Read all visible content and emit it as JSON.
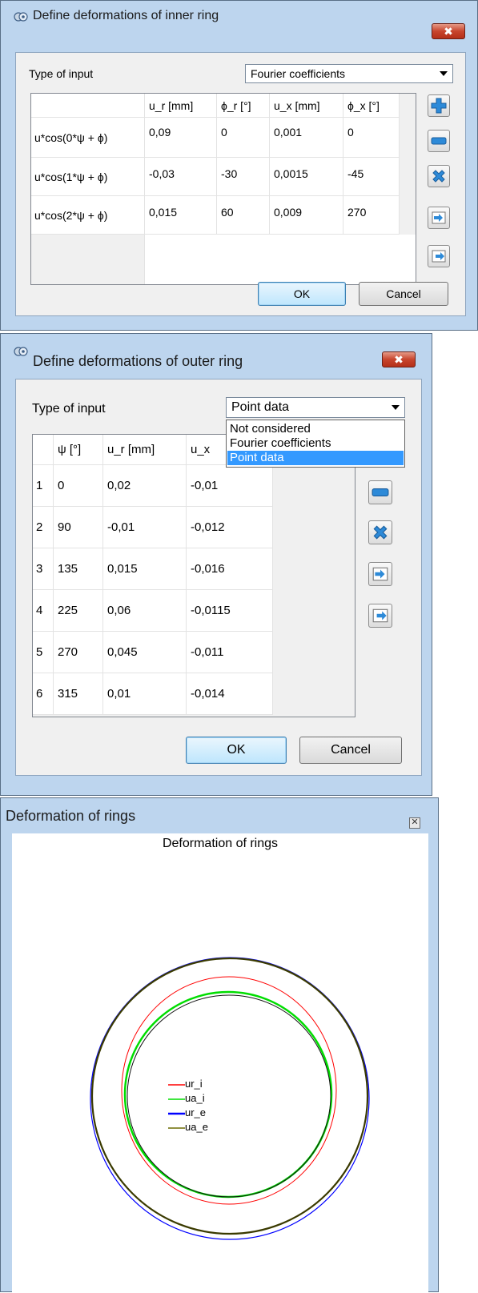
{
  "inner_dialog": {
    "title": "Define deformations of inner ring",
    "type_label": "Type of input",
    "type_value": "Fourier coefficients",
    "headers": [
      "u_r [mm]",
      "ϕ_r [°]",
      "u_x [mm]",
      "ϕ_x [°]"
    ],
    "rows": [
      {
        "label": "u*cos(0*ψ + ϕ)",
        "cells": [
          "0,09",
          "0",
          "0,001",
          "0"
        ]
      },
      {
        "label": "u*cos(1*ψ + ϕ)",
        "cells": [
          "-0,03",
          "-30",
          "0,0015",
          "-45"
        ]
      },
      {
        "label": "u*cos(2*ψ + ϕ)",
        "cells": [
          "0,015",
          "60",
          "0,009",
          "270"
        ]
      }
    ],
    "ok_label": "OK",
    "cancel_label": "Cancel",
    "close_glyph": "✖"
  },
  "outer_dialog": {
    "title": "Define deformations of outer ring",
    "type_label": "Type of input",
    "type_value": "Point data",
    "headers": [
      "ψ [°]",
      "u_r [mm]",
      "u_x"
    ],
    "rows": [
      {
        "num": "1",
        "cells": [
          "0",
          "0,02",
          "-0,01"
        ]
      },
      {
        "num": "2",
        "cells": [
          "90",
          "-0,01",
          "-0,012"
        ]
      },
      {
        "num": "3",
        "cells": [
          "135",
          "0,015",
          "-0,016"
        ]
      },
      {
        "num": "4",
        "cells": [
          "225",
          "0,06",
          "-0,0115"
        ]
      },
      {
        "num": "5",
        "cells": [
          "270",
          "0,045",
          "-0,011"
        ]
      },
      {
        "num": "6",
        "cells": [
          "315",
          "0,01",
          "-0,014"
        ]
      }
    ],
    "dropdown_options": [
      "Not considered",
      "Fourier coefficients",
      "Point data"
    ],
    "dropdown_selected": "Point data",
    "ok_label": "OK",
    "cancel_label": "Cancel",
    "close_glyph": "✖"
  },
  "plot_window": {
    "window_title": "Deformation of rings",
    "plot_title": "Deformation of rings",
    "close_glyph": "✕",
    "legend": [
      {
        "name": "ur_i",
        "color": "#ff0000"
      },
      {
        "name": "ua_i",
        "color": "#00dd00"
      },
      {
        "name": "ur_e",
        "color": "#0000ff"
      },
      {
        "name": "ua_e",
        "color": "#6b6b00"
      }
    ]
  },
  "icons": {
    "add": "plus-icon",
    "remove": "minus-icon",
    "clear": "delete-x-icon",
    "import": "import-icon",
    "export": "export-icon",
    "app": "gear-app-icon"
  }
}
